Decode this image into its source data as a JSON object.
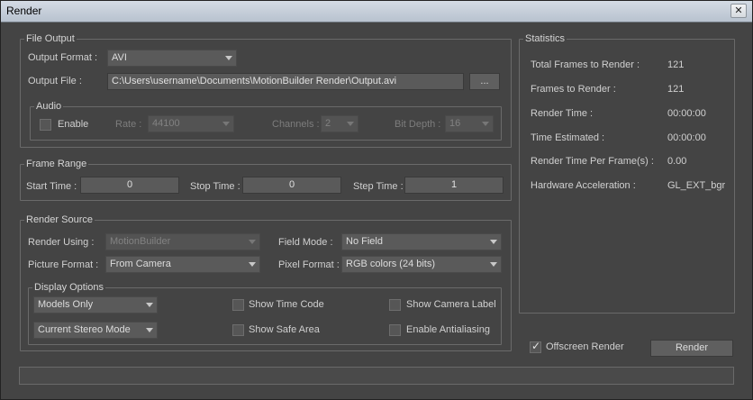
{
  "window": {
    "title": "Render",
    "close_glyph": "✕"
  },
  "file_output": {
    "legend": "File Output",
    "format_label": "Output Format :",
    "format_value": "AVI",
    "file_label": "Output File :",
    "file_value": "C:\\Users\\username\\Documents\\MotionBuilder Render\\Output.avi",
    "browse_label": "...",
    "audio": {
      "legend": "Audio",
      "enable_label": "Enable",
      "rate_label": "Rate :",
      "rate_value": "44100",
      "channels_label": "Channels :",
      "channels_value": "2",
      "bitdepth_label": "Bit Depth :",
      "bitdepth_value": "16"
    }
  },
  "frame_range": {
    "legend": "Frame Range",
    "start_label": "Start Time :",
    "start_value": "0",
    "stop_label": "Stop Time :",
    "stop_value": "0",
    "step_label": "Step Time :",
    "step_value": "1"
  },
  "render_source": {
    "legend": "Render Source",
    "render_using_label": "Render Using :",
    "render_using_value": "MotionBuilder",
    "field_mode_label": "Field Mode :",
    "field_mode_value": "No Field",
    "picture_format_label": "Picture Format :",
    "picture_format_value": "From Camera",
    "pixel_format_label": "Pixel Format :",
    "pixel_format_value": "RGB colors (24 bits)",
    "display_options": {
      "legend": "Display Options",
      "models_value": "Models Only",
      "stereo_value": "Current Stereo Mode",
      "show_time_code": "Show Time Code",
      "show_safe_area": "Show Safe Area",
      "show_camera_label": "Show Camera Label",
      "enable_antialiasing": "Enable Antialiasing"
    }
  },
  "statistics": {
    "legend": "Statistics",
    "rows": [
      {
        "label": "Total Frames to Render :",
        "value": "121"
      },
      {
        "label": "Frames to Render :",
        "value": "121"
      },
      {
        "label": "Render Time :",
        "value": "00:00:00"
      },
      {
        "label": "Time Estimated :",
        "value": "00:00:00"
      },
      {
        "label": "Render Time Per Frame(s) :",
        "value": "0.00"
      },
      {
        "label": "Hardware Acceleration :",
        "value": "GL_EXT_bgr"
      }
    ]
  },
  "footer": {
    "offscreen_label": "Offscreen Render",
    "offscreen_checked": true,
    "render_button": "Render"
  },
  "colors": {
    "background": "#444444",
    "field": "#5a5a5a",
    "border": "#6a6a6a",
    "text": "#d6d6d6"
  }
}
